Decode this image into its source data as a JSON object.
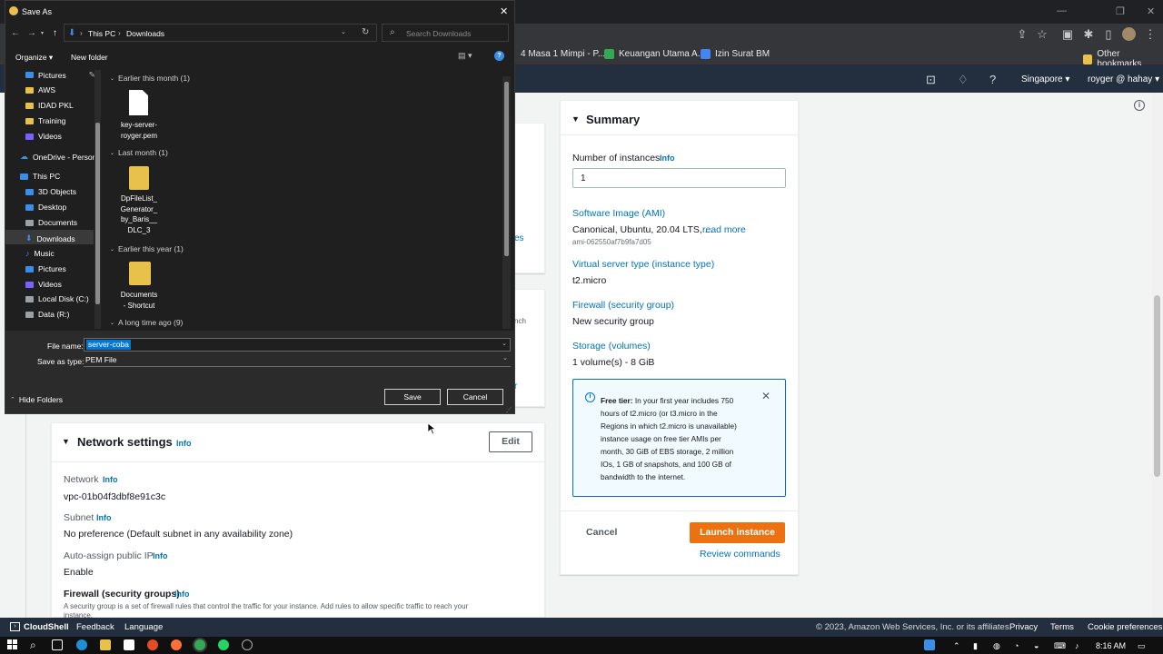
{
  "browser": {
    "bookmarks": [
      {
        "label": "4 Masa 1 Mimpi - P...",
        "color": "#d8d8d8"
      },
      {
        "label": "Keuangan Utama A...",
        "color": "#34a853"
      },
      {
        "label": "Izin Surat BM",
        "color": "#4285f4"
      }
    ],
    "other_bookmarks": "Other bookmarks"
  },
  "aws_header": {
    "region": "Singapore ▾",
    "account": "royger @ hahay ▾"
  },
  "summary": {
    "title": "Summary",
    "instances_label": "Number of instances",
    "instances_info": "Info",
    "instances_value": "1",
    "ami_label": "Software Image (AMI)",
    "ami_value": "Canonical, Ubuntu, 20.04 LTS, ...",
    "ami_read_more": "read more",
    "ami_id": "ami-062550af7b9fa7d05",
    "type_label": "Virtual server type (instance type)",
    "type_value": "t2.micro",
    "firewall_label": "Firewall (security group)",
    "firewall_value": "New security group",
    "storage_label": "Storage (volumes)",
    "storage_value": "1 volume(s) - 8 GiB",
    "free_tier_bold": "Free tier:",
    "free_tier_lines": [
      " In your first year includes 750",
      "hours of t2.micro (or t3.micro in the",
      "Regions in which t2.micro is unavailable)",
      "instance usage on free tier AMIs per",
      "month, 30 GiB of EBS storage, 2 million",
      "IOs, 1 GB of snapshots, and 100 GB of",
      "bandwidth to the internet."
    ],
    "cancel": "Cancel",
    "launch": "Launch instance",
    "review": "Review commands"
  },
  "network": {
    "title": "Network settings",
    "info": "Info",
    "edit": "Edit",
    "network_label": "Network",
    "network_value": "vpc-01b04f3dbf8e91c3c",
    "subnet_label": "Subnet",
    "subnet_value": "No preference (Default subnet in any availability zone)",
    "public_ip_label": "Auto-assign public IP",
    "public_ip_value": "Enable",
    "firewall_label": "Firewall (security groups)",
    "firewall_desc": "A security group is a set of firewall rules that control the traffic for your instance. Add rules to allow specific traffic to reach your",
    "firewall_desc2": "instance."
  },
  "left_fragments": {
    "es": "es",
    "nch": "nch",
    "r": "r"
  },
  "footer": {
    "cloudshell": "CloudShell",
    "feedback": "Feedback",
    "language": "Language",
    "copyright": "© 2023, Amazon Web Services, Inc. or its affiliates.",
    "privacy": "Privacy",
    "terms": "Terms",
    "cookie": "Cookie preferences"
  },
  "taskbar": {
    "time": "8:16 AM"
  },
  "dialog": {
    "title": "Save As",
    "breadcrumb": [
      "This PC",
      "Downloads"
    ],
    "search_placeholder": "Search Downloads",
    "organize": "Organize ▾",
    "new_folder": "New folder",
    "sidebar": [
      "Pictures",
      "AWS",
      "IDAD PKL",
      "Training",
      "Videos",
      "OneDrive - Person",
      "This PC",
      "3D Objects",
      "Desktop",
      "Documents",
      "Downloads",
      "Music",
      "Pictures",
      "Videos",
      "Local Disk (C:)",
      "Data (R:)"
    ],
    "groups": [
      {
        "label": "Earlier this month (1)"
      },
      {
        "label": "Last month (1)"
      },
      {
        "label": "Earlier this year (1)"
      },
      {
        "label": "A long time ago (9)"
      }
    ],
    "files": [
      {
        "line1": "key-server-",
        "line2": "royger.pem",
        "line3": "",
        "line4": ""
      },
      {
        "line1": "DpFileList_",
        "line2": "Generator_",
        "line3": "by_Baris__",
        "line4": "DLC_3"
      },
      {
        "line1": "Documents",
        "line2": "- Shortcut",
        "line3": "",
        "line4": ""
      }
    ],
    "file_name_label": "File name:",
    "file_name_value": "server-coba",
    "save_type_label": "Save as type:",
    "save_type_value": "PEM File",
    "hide_folders": "Hide Folders",
    "save": "Save",
    "cancel": "Cancel"
  }
}
